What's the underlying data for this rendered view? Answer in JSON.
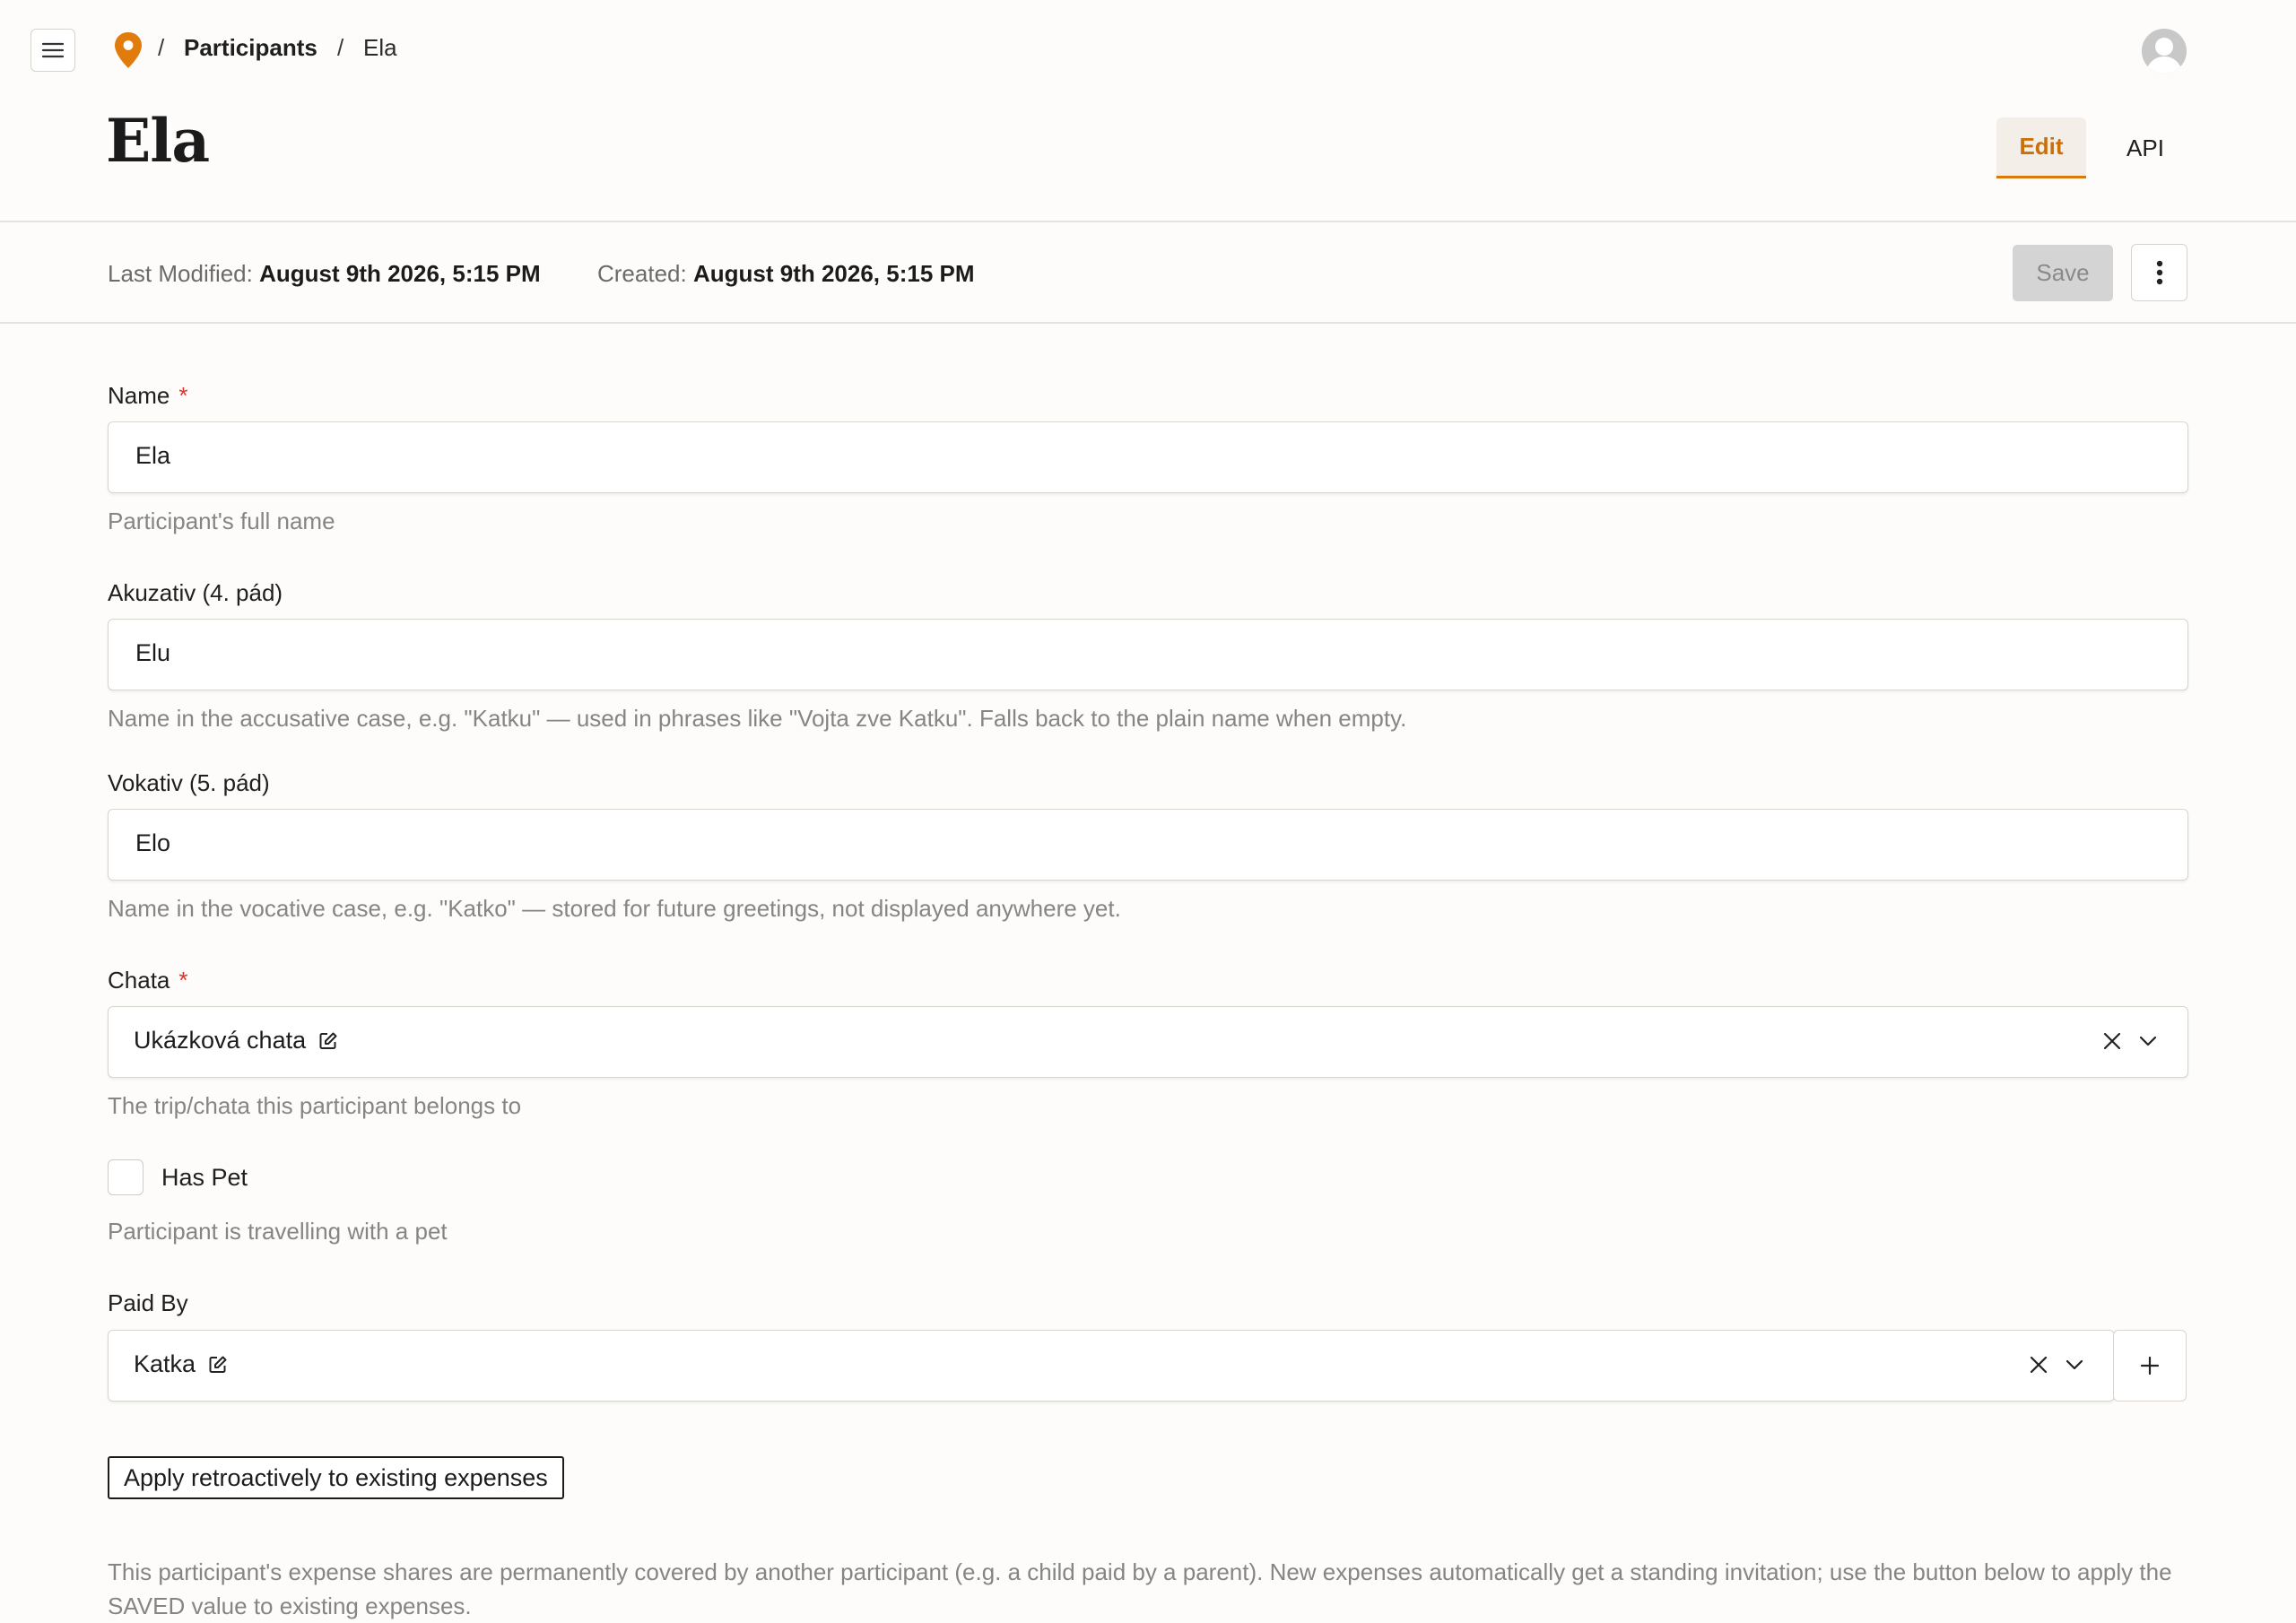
{
  "breadcrumb": {
    "separator": "/",
    "link": "Participants",
    "current": "Ela"
  },
  "header": {
    "title": "Ela",
    "tabs": [
      {
        "label": "Edit",
        "active": true
      },
      {
        "label": "API",
        "active": false
      }
    ]
  },
  "meta": {
    "last_modified_label": "Last Modified:",
    "last_modified_value": "August 9th 2026, 5:15 PM",
    "created_label": "Created:",
    "created_value": "August 9th 2026, 5:15 PM"
  },
  "toolbar": {
    "save_label": "Save"
  },
  "form": {
    "required_mark": "*",
    "name": {
      "label": "Name",
      "value": "Ela",
      "help": "Participant's full name"
    },
    "akuzativ": {
      "label": "Akuzativ (4. pád)",
      "value": "Elu",
      "help": "Name in the accusative case, e.g. \"Katku\" — used in phrases like \"Vojta zve Katku\". Falls back to the plain name when empty."
    },
    "vokativ": {
      "label": "Vokativ (5. pád)",
      "value": "Elo",
      "help": "Name in the vocative case, e.g. \"Katko\" — stored for future greetings, not displayed anywhere yet."
    },
    "chata": {
      "label": "Chata",
      "value": "Ukázková chata",
      "help": "The trip/chata this participant belongs to"
    },
    "has_pet": {
      "label": "Has Pet",
      "checked": false,
      "help": "Participant is travelling with a pet"
    },
    "paid_by": {
      "label": "Paid By",
      "value": "Katka"
    },
    "retro_button": "Apply retroactively to existing expenses",
    "paid_by_help": "This participant's expense shares are permanently covered by another participant (e.g. a child paid by a parent). New expenses automatically get a standing invitation; use the button below to apply the SAVED value to existing expenses."
  },
  "colors": {
    "accent": "#d97a0b",
    "required": "#d6362a",
    "background": "#fdfcfa",
    "muted_text": "#858585"
  },
  "icons": {
    "menu": "hamburger-icon",
    "logo": "map-pin-icon",
    "avatar": "user-avatar-icon",
    "more": "kebab-icon",
    "edit_link": "edit-square-icon",
    "clear": "close-icon",
    "dropdown": "chevron-down-icon",
    "add": "plus-icon"
  }
}
